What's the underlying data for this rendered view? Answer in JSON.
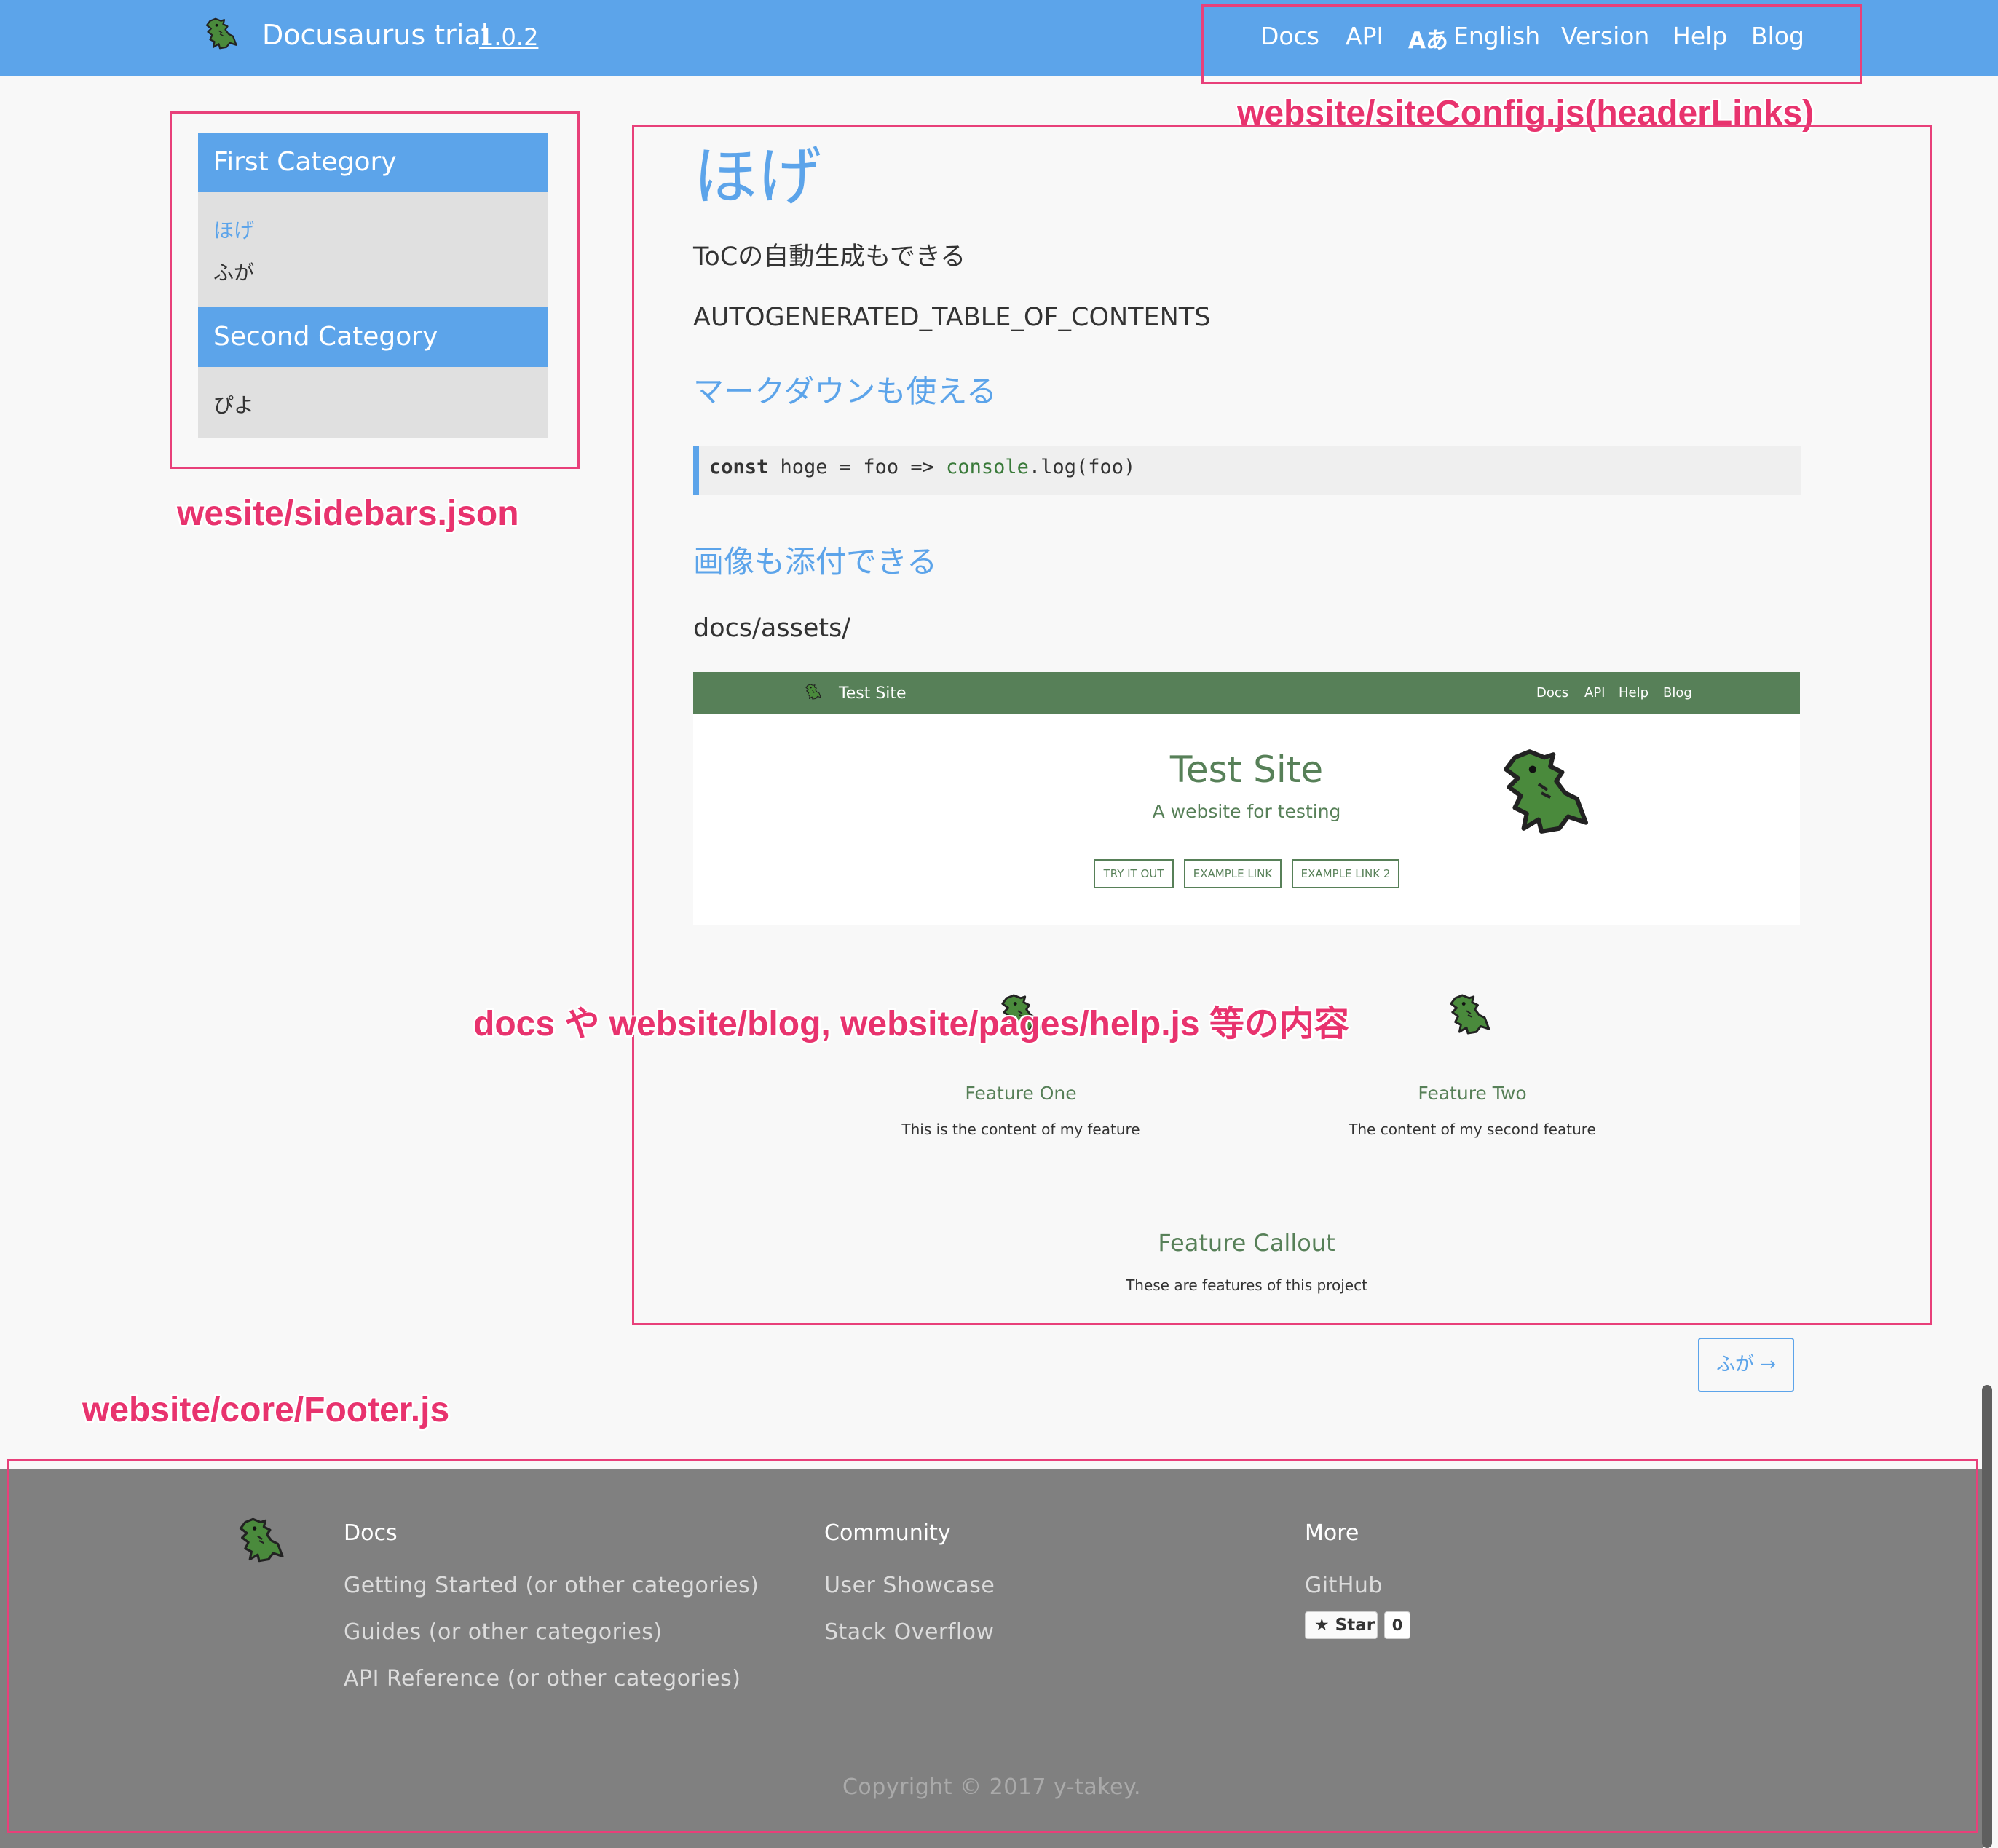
{
  "header": {
    "site_title": "Docusaurus trial",
    "version": "1.0.2",
    "nav": [
      {
        "label": "Docs"
      },
      {
        "label": "API"
      },
      {
        "label": "English",
        "icon": "translate-icon"
      },
      {
        "label": "Version"
      },
      {
        "label": "Help"
      },
      {
        "label": "Blog"
      }
    ],
    "translate_glyph": "Aあ"
  },
  "sidebar": {
    "categories": [
      {
        "title": "First Category",
        "items": [
          {
            "label": "ほげ",
            "active": true
          },
          {
            "label": "ふが",
            "active": false
          }
        ]
      },
      {
        "title": "Second Category",
        "items": [
          {
            "label": "ぴよ",
            "active": false
          }
        ]
      }
    ]
  },
  "content": {
    "title": "ほげ",
    "toc_note": "ToCの自動生成もできる",
    "toc_placeholder": "AUTOGENERATED_TABLE_OF_CONTENTS",
    "markdown_heading": "マークダウンも使える",
    "code": {
      "keyword": "const",
      "mid": " hoge = foo => ",
      "fn": "console",
      "rest": ".log(foo)"
    },
    "image_heading": "画像も添付できる",
    "image_path": "docs/assets/",
    "screenshot": {
      "brand": "Test Site",
      "nav": [
        "Docs",
        "API",
        "Help",
        "Blog"
      ],
      "title": "Test Site",
      "subtitle": "A website for testing",
      "buttons": [
        "TRY IT OUT",
        "EXAMPLE LINK",
        "EXAMPLE LINK 2"
      ],
      "features": [
        {
          "title": "Feature One",
          "text": "This is the content of my feature"
        },
        {
          "title": "Feature Two",
          "text": "The content of my second feature"
        }
      ],
      "callout_title": "Feature Callout",
      "callout_text": "These are features of this project"
    },
    "next_button": "ふが →"
  },
  "footer": {
    "columns": [
      {
        "heading": "Docs",
        "links": [
          "Getting Started (or other categories)",
          "Guides (or other categories)",
          "API Reference (or other categories)"
        ]
      },
      {
        "heading": "Community",
        "links": [
          "User Showcase",
          "Stack Overflow"
        ]
      },
      {
        "heading": "More",
        "links": [
          "GitHub"
        ]
      }
    ],
    "star_label": "Star",
    "star_count": "0",
    "copyright": "Copyright © 2017 y-takey."
  },
  "annotations": {
    "header": "website/siteConfig.js(headerLinks)",
    "sidebar": "wesite/sidebars.json",
    "content": "docs や website/blog, website/pages/help.js 等の内容",
    "footer": "website/core/Footer.js"
  },
  "colors": {
    "header_bg": "#5ca4ea",
    "accent": "#5ca4ea",
    "test_site_green": "#578058",
    "footer_bg": "#808080",
    "annotation": "#e8407a"
  }
}
